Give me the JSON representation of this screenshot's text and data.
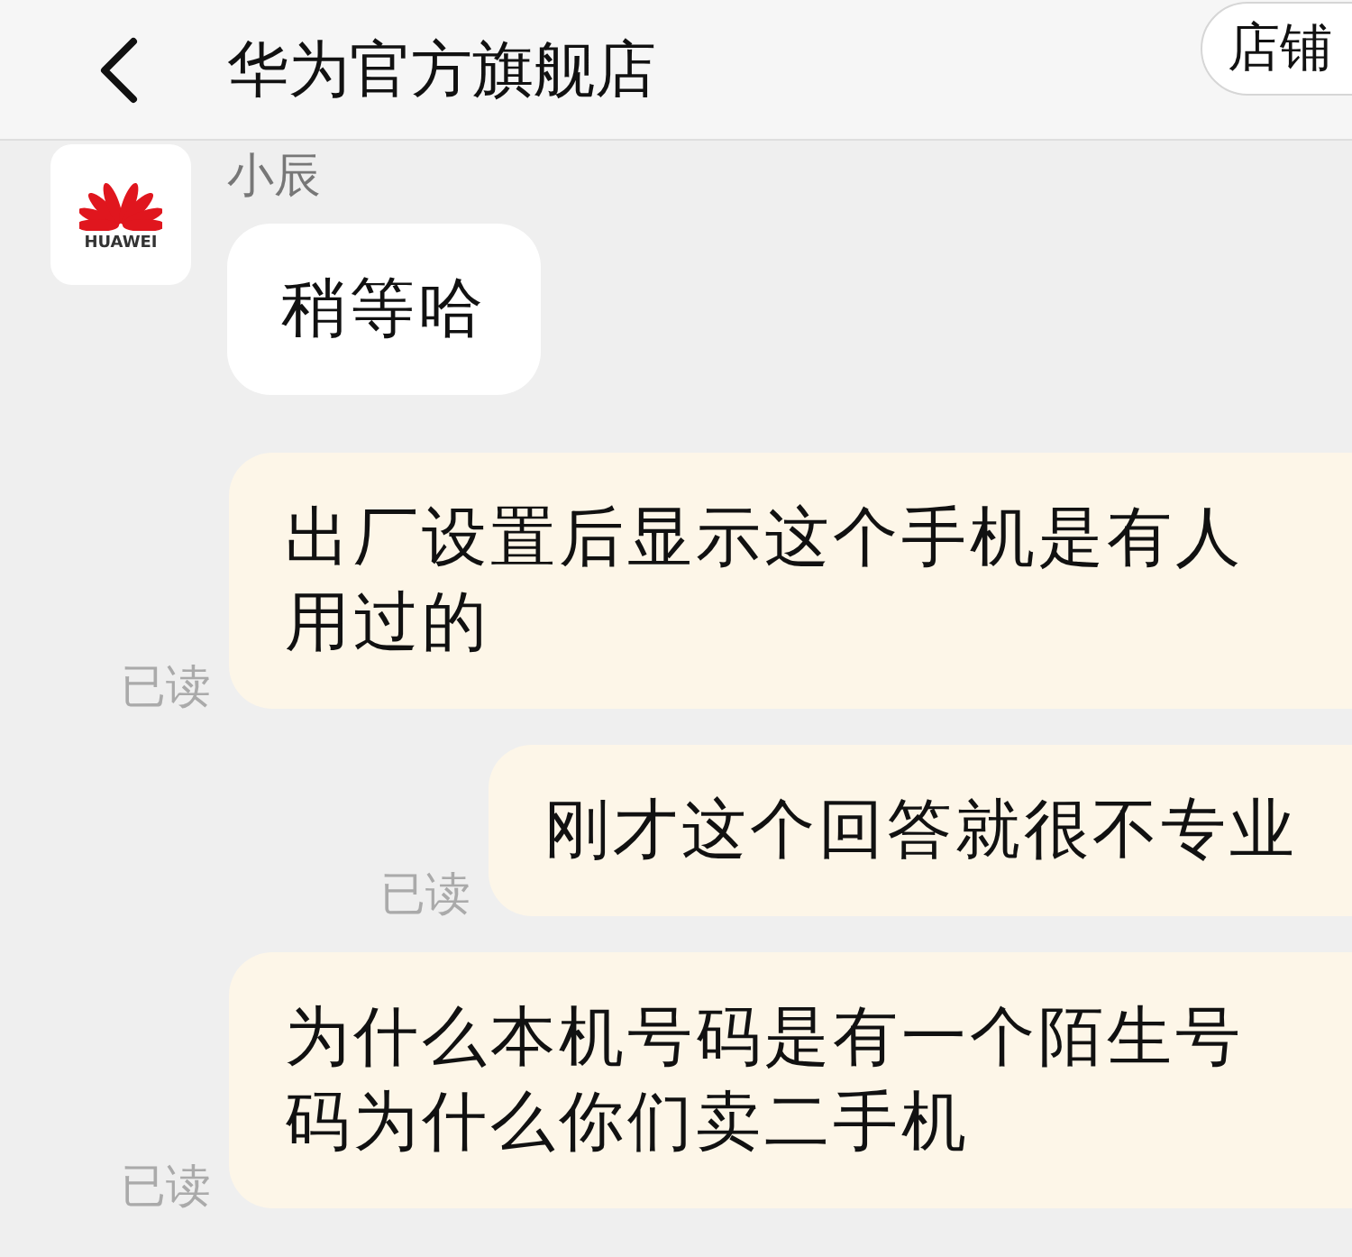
{
  "header": {
    "title": "华为官方旗舰店",
    "shop_button": "店铺"
  },
  "messages": [
    {
      "kind": "received",
      "sender": "小辰",
      "avatar_label": "HUAWEI",
      "text": "稍等哈"
    },
    {
      "kind": "sent",
      "text": "出厂设置后显示这个手机是有人用过的",
      "status": "已读"
    },
    {
      "kind": "sent",
      "text": "刚才这个回答就很不专业",
      "status": "已读"
    },
    {
      "kind": "sent",
      "text": "为什么本机号码是有一个陌生号码为什么你们卖二手机",
      "status": "已读"
    }
  ]
}
